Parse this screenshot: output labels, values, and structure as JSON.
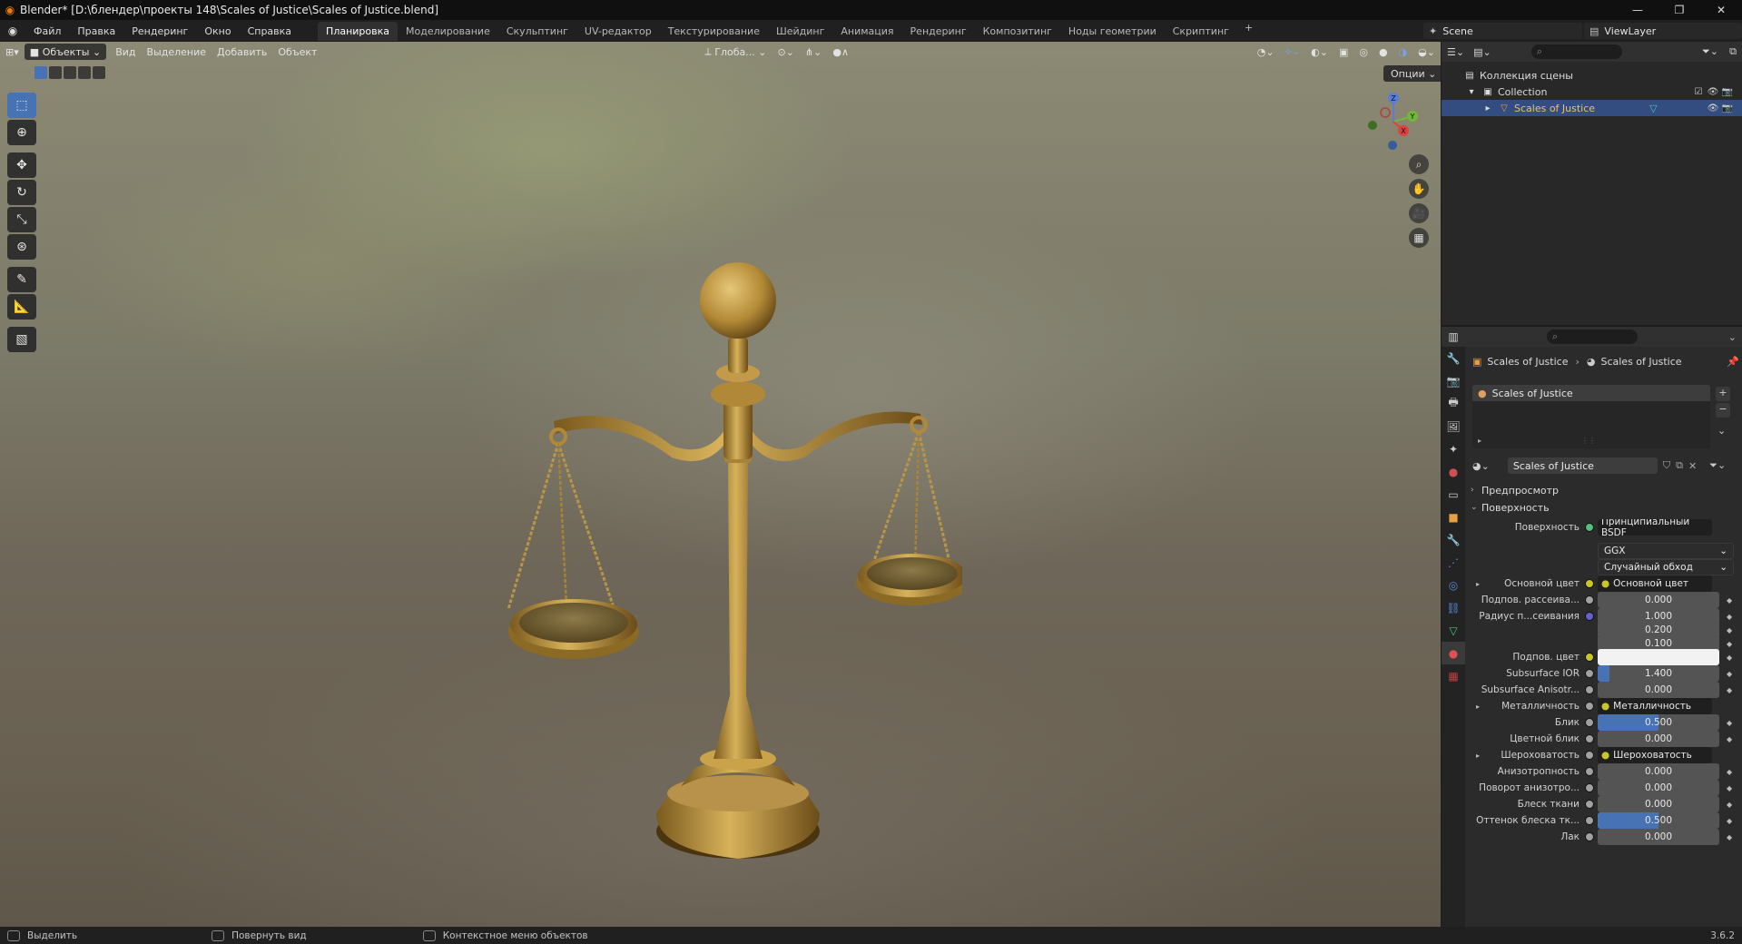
{
  "window": {
    "title": "Blender* [D:\\блендер\\проекты 148\\Scales of Justice\\Scales of Justice.blend]",
    "minimize": "—",
    "maximize": "❐",
    "close": "✕"
  },
  "menu": {
    "items": [
      "Файл",
      "Правка",
      "Рендеринг",
      "Окно",
      "Справка"
    ],
    "workspaces": [
      "Планировка",
      "Моделирование",
      "Скульптинг",
      "UV-редактор",
      "Текстурирование",
      "Шейдинг",
      "Анимация",
      "Рендеринг",
      "Композитинг",
      "Ноды геометрии",
      "Скриптинг"
    ],
    "active_workspace": "Планировка",
    "add": "+",
    "scene": "Scene",
    "view_layer": "ViewLayer"
  },
  "viewport": {
    "mode": "Объекты",
    "header_menus": [
      "Вид",
      "Выделение",
      "Добавить",
      "Объект"
    ],
    "orientation": "Глоба...",
    "options": "Опции",
    "gizmo_axes": {
      "x": "X",
      "y": "Y",
      "z": "Z"
    }
  },
  "outliner": {
    "scene_collection": "Коллекция сцены",
    "collection": "Collection",
    "object": "Scales of Justice"
  },
  "properties": {
    "breadcrumb_object": "Scales of Justice",
    "breadcrumb_material": "Scales of Justice",
    "slot": "Scales of Justice",
    "material_name": "Scales of Justice",
    "panels": {
      "preview": "Предпросмотр",
      "surface": "Поверхность"
    },
    "surface_label": "Поверхность",
    "surface_shader": "Принципиальный BSDF",
    "distribution": "GGX",
    "subsurface_method": "Случайный обход",
    "rows": [
      {
        "label": "Основной цвет",
        "value": "Основной цвет",
        "kind": "link",
        "socket": "#c7c729",
        "expander": true
      },
      {
        "label": "Подпов. рассеива...",
        "value": "0.000",
        "kind": "number",
        "socket": "#a1a1a1",
        "fill": 0
      },
      {
        "label": "Радиус п...сеивания",
        "value": "1.000",
        "kind": "number",
        "socket": "#6363c7",
        "fill": 0
      },
      {
        "label": "",
        "value": "0.200",
        "kind": "number",
        "socket": "",
        "fill": 0
      },
      {
        "label": "",
        "value": "0.100",
        "kind": "number",
        "socket": "",
        "fill": 0
      },
      {
        "label": "Подпов. цвет",
        "value": "",
        "kind": "color",
        "socket": "#c7c729",
        "color": "#f2f2f2"
      },
      {
        "label": "Subsurface IOR",
        "value": "1.400",
        "kind": "number",
        "socket": "#a1a1a1",
        "fill": 0.1
      },
      {
        "label": "Subsurface Anisotr...",
        "value": "0.000",
        "kind": "number",
        "socket": "#a1a1a1",
        "fill": 0
      },
      {
        "label": "Металличность",
        "value": "Металличность",
        "kind": "link",
        "socket": "#a1a1a1",
        "expander": true
      },
      {
        "label": "Блик",
        "value": "0.500",
        "kind": "number",
        "socket": "#a1a1a1",
        "fill": 0.5
      },
      {
        "label": "Цветной блик",
        "value": "0.000",
        "kind": "number",
        "socket": "#a1a1a1",
        "fill": 0
      },
      {
        "label": "Шероховатость",
        "value": "Шероховатость",
        "kind": "link",
        "socket": "#a1a1a1",
        "expander": true
      },
      {
        "label": "Анизотропность",
        "value": "0.000",
        "kind": "number",
        "socket": "#a1a1a1",
        "fill": 0
      },
      {
        "label": "Поворот анизотро...",
        "value": "0.000",
        "kind": "number",
        "socket": "#a1a1a1",
        "fill": 0
      },
      {
        "label": "Блеск ткани",
        "value": "0.000",
        "kind": "number",
        "socket": "#a1a1a1",
        "fill": 0
      },
      {
        "label": "Оттенок блеска тк...",
        "value": "0.500",
        "kind": "number",
        "socket": "#a1a1a1",
        "fill": 0.5
      },
      {
        "label": "Лак",
        "value": "0.000",
        "kind": "number",
        "socket": "#a1a1a1",
        "fill": 0
      }
    ]
  },
  "statusbar": {
    "select": "Выделить",
    "rotate": "Повернуть вид",
    "context": "Контекстное меню объектов",
    "version": "3.6.2"
  },
  "colors": {
    "accent": "#4772b3",
    "blender_orange": "#e87d0d",
    "selected_row": "#334d80",
    "brass": "#c9a24a"
  }
}
